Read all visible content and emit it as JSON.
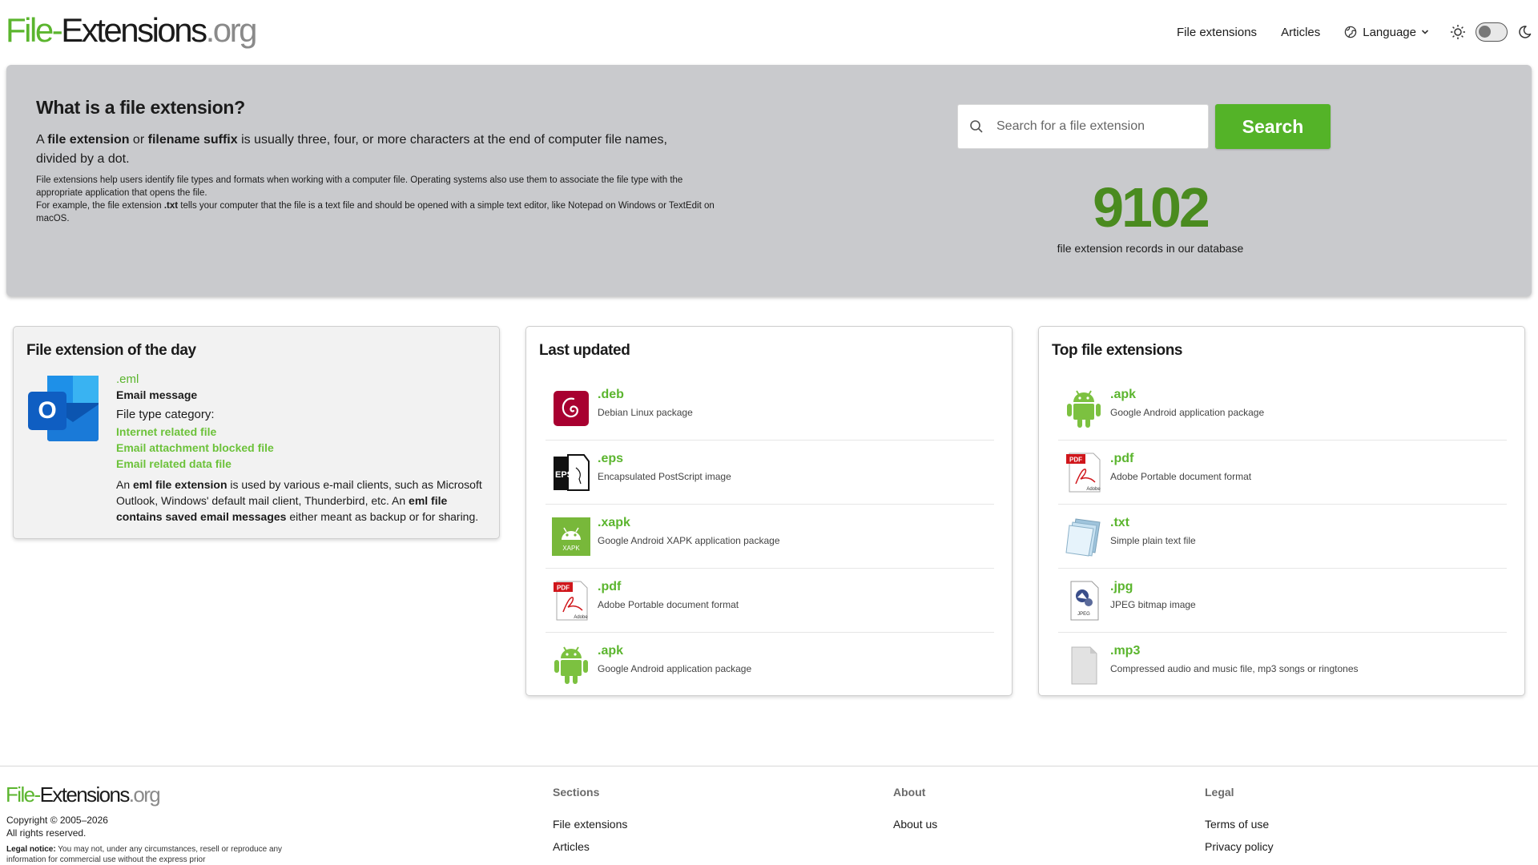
{
  "logo": {
    "file": "File",
    "dash": "-",
    "ext": "Extensions",
    "org": ".org"
  },
  "nav": {
    "file_extensions": "File extensions",
    "articles": "Articles",
    "language": "Language"
  },
  "hero": {
    "title": "What is a file extension?",
    "lead_pre": "A ",
    "lead_b1": "file extension",
    "lead_mid": " or ",
    "lead_b2": "filename suffix",
    "lead_post": " is usually three, four, or more characters at the end of computer file names, divided by a dot.",
    "small_line1": "File extensions help users identify file types and formats when working with a computer file. Operating systems also use them to associate the file type with the appropriate application that opens the file.",
    "small_pre": "For example, the file extension ",
    "small_b": ".txt",
    "small_post": " tells your computer that the file is a text file and should be opened with a simple text editor, like Notepad on Windows or TextEdit on macOS.",
    "search_placeholder": "Search for a file extension",
    "search_button": "Search",
    "count": "9102",
    "count_label": "file extension records in our database"
  },
  "day": {
    "title": "File extension of the day",
    "ext": ".eml",
    "name": "Email message",
    "category_label": "File type category:",
    "categories": [
      "Internet related file",
      "Email attachment blocked file",
      "Email related data file"
    ],
    "desc_1": "An ",
    "desc_b1": "eml file extension",
    "desc_2": " is used by various e-mail clients, such as Microsoft Outlook, Windows' default mail client, Thunderbird, etc. An ",
    "desc_b2": "eml file contains saved email messages",
    "desc_3": " either meant as backup or for sharing."
  },
  "last_updated": {
    "title": "Last updated",
    "items": [
      {
        "ext": ".deb",
        "desc": "Debian Linux package",
        "icon": "debian-icon"
      },
      {
        "ext": ".eps",
        "desc": "Encapsulated PostScript image",
        "icon": "eps-icon"
      },
      {
        "ext": ".xapk",
        "desc": "Google Android XAPK application package",
        "icon": "xapk-icon"
      },
      {
        "ext": ".pdf",
        "desc": "Adobe Portable document format",
        "icon": "pdf-icon"
      },
      {
        "ext": ".apk",
        "desc": "Google Android application package",
        "icon": "android-icon"
      }
    ]
  },
  "top": {
    "title": "Top file extensions",
    "items": [
      {
        "ext": ".apk",
        "desc": "Google Android application package",
        "icon": "android-icon"
      },
      {
        "ext": ".pdf",
        "desc": "Adobe Portable document format",
        "icon": "pdf-icon"
      },
      {
        "ext": ".txt",
        "desc": "Simple plain text file",
        "icon": "text-file-icon"
      },
      {
        "ext": ".jpg",
        "desc": "JPEG bitmap image",
        "icon": "jpeg-icon"
      },
      {
        "ext": ".mp3",
        "desc": "Compressed audio and music file, mp3 songs or ringtones",
        "icon": "generic-file-icon"
      }
    ]
  },
  "icon_labels": {
    "eps": "EPS",
    "xapk": "XAPK",
    "pdf": "PDF",
    "adobe": "Adobe",
    "jpeg": "JPEG",
    "outlook": "O"
  },
  "footer": {
    "copyright": "Copyright © 2005–2026",
    "rights": "All rights reserved.",
    "legal_label": "Legal notice:",
    "legal_text": " You may not, under any circumstances, resell or reproduce any information for commercial use without the express prior",
    "sections_title": "Sections",
    "sections": [
      "File extensions",
      "Articles"
    ],
    "about_title": "About",
    "about": [
      "About us"
    ],
    "legal_title": "Legal",
    "legal_links": [
      "Terms of use",
      "Privacy policy"
    ]
  },
  "colors": {
    "brand_green": "#5bb52e",
    "count_green": "#4a8b1f",
    "hero_bg": "#c9cacd"
  }
}
